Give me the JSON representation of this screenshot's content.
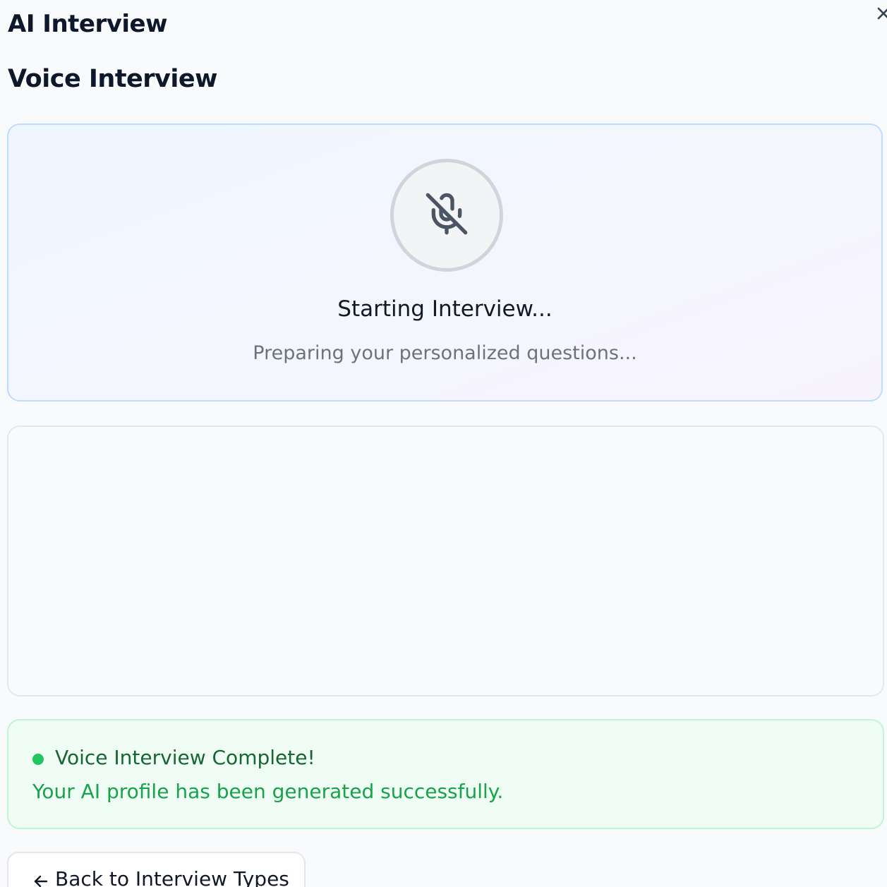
{
  "header": {
    "app_title": "AI Interview",
    "close_icon": "close-icon"
  },
  "main": {
    "section_title": "Voice Interview",
    "status_card": {
      "icon": "mic-off-icon",
      "heading": "Starting Interview...",
      "subtext": "Preparing your personalized questions..."
    },
    "transcript": {
      "messages": []
    },
    "success_card": {
      "icon": "status-dot",
      "title": "Voice Interview Complete!",
      "message": "Your AI profile has been generated successfully."
    },
    "back_button": {
      "icon": "arrow-left-icon",
      "label": "Back to Interview Types"
    }
  },
  "colors": {
    "success_dot": "#22c55e",
    "success_title": "#166534",
    "success_text": "#16a34a",
    "status_border": "#bfdbfe",
    "muted_text": "#6b7280"
  }
}
